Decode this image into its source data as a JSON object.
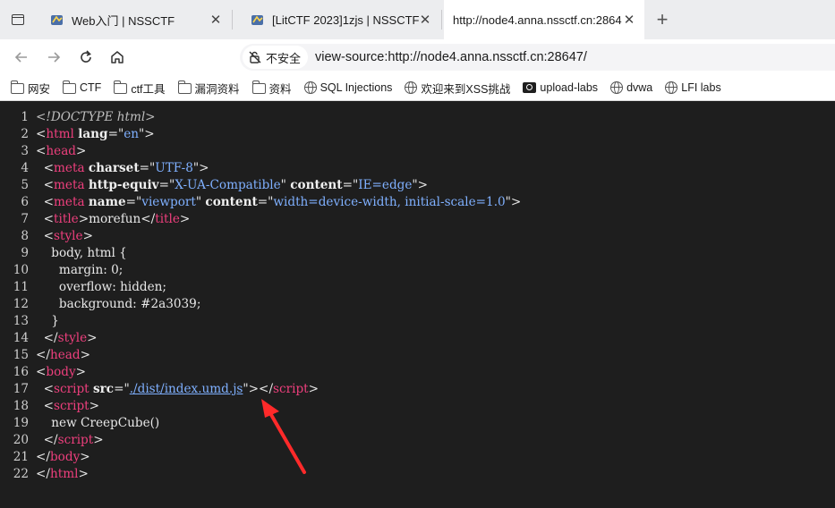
{
  "tabs": [
    {
      "title": "Web入门 | NSSCTF",
      "active": false,
      "closable": true
    },
    {
      "title": "[LitCTF 2023]1zjs | NSSCTF",
      "active": false,
      "closable": true
    },
    {
      "title": "http://node4.anna.nssctf.cn:2864",
      "active": true,
      "closable": true
    }
  ],
  "address_bar": {
    "security_label": "不安全",
    "url": "view-source:http://node4.anna.nssctf.cn:28647/"
  },
  "bookmarks": [
    {
      "label": "网安",
      "icon": "folder-icon"
    },
    {
      "label": "CTF",
      "icon": "folder-icon"
    },
    {
      "label": "ctf工具",
      "icon": "folder-icon"
    },
    {
      "label": "漏洞资料",
      "icon": "folder-icon"
    },
    {
      "label": "资料",
      "icon": "folder-icon"
    },
    {
      "label": "SQL Injections",
      "icon": "globe-icon"
    },
    {
      "label": "欢迎来到XSS挑战",
      "icon": "globe-icon"
    },
    {
      "label": "upload-labs",
      "icon": "upload-icon"
    },
    {
      "label": "dvwa",
      "icon": "globe-icon"
    },
    {
      "label": "LFI labs",
      "icon": "globe-icon"
    }
  ],
  "source_lines": [
    {
      "n": "1",
      "parts": [
        [
          "doctype",
          "<!DOCTYPE html>"
        ]
      ]
    },
    {
      "n": "2",
      "parts": [
        [
          "text",
          "<"
        ],
        [
          "tag",
          "html"
        ],
        [
          "text",
          " "
        ],
        [
          "attr",
          "lang"
        ],
        [
          "text",
          "=\""
        ],
        [
          "val",
          "en"
        ],
        [
          "text",
          "\">"
        ]
      ]
    },
    {
      "n": "3",
      "parts": [
        [
          "text",
          "<"
        ],
        [
          "tag",
          "head"
        ],
        [
          "text",
          ">"
        ]
      ]
    },
    {
      "n": "4",
      "parts": [
        [
          "text",
          "  <"
        ],
        [
          "tag",
          "meta"
        ],
        [
          "text",
          " "
        ],
        [
          "attr",
          "charset"
        ],
        [
          "text",
          "=\""
        ],
        [
          "val",
          "UTF-8"
        ],
        [
          "text",
          "\">"
        ]
      ]
    },
    {
      "n": "5",
      "parts": [
        [
          "text",
          "  <"
        ],
        [
          "tag",
          "meta"
        ],
        [
          "text",
          " "
        ],
        [
          "attr",
          "http-equiv"
        ],
        [
          "text",
          "=\""
        ],
        [
          "val",
          "X-UA-Compatible"
        ],
        [
          "text",
          "\" "
        ],
        [
          "attr",
          "content"
        ],
        [
          "text",
          "=\""
        ],
        [
          "val",
          "IE=edge"
        ],
        [
          "text",
          "\">"
        ]
      ]
    },
    {
      "n": "6",
      "parts": [
        [
          "text",
          "  <"
        ],
        [
          "tag",
          "meta"
        ],
        [
          "text",
          " "
        ],
        [
          "attr",
          "name"
        ],
        [
          "text",
          "=\""
        ],
        [
          "val",
          "viewport"
        ],
        [
          "text",
          "\" "
        ],
        [
          "attr",
          "content"
        ],
        [
          "text",
          "=\""
        ],
        [
          "val",
          "width=device-width, initial-scale=1.0"
        ],
        [
          "text",
          "\">"
        ]
      ]
    },
    {
      "n": "7",
      "parts": [
        [
          "text",
          "  <"
        ],
        [
          "tag",
          "title"
        ],
        [
          "text",
          ">morefun</"
        ],
        [
          "tag",
          "title"
        ],
        [
          "text",
          ">"
        ]
      ]
    },
    {
      "n": "8",
      "parts": [
        [
          "text",
          "  <"
        ],
        [
          "tag",
          "style"
        ],
        [
          "text",
          ">"
        ]
      ]
    },
    {
      "n": "9",
      "parts": [
        [
          "text",
          "    body, html {"
        ]
      ]
    },
    {
      "n": "10",
      "parts": [
        [
          "text",
          "      margin: 0;"
        ]
      ]
    },
    {
      "n": "11",
      "parts": [
        [
          "text",
          "      overflow: hidden;"
        ]
      ]
    },
    {
      "n": "12",
      "parts": [
        [
          "text",
          "      background: #2a3039;"
        ]
      ]
    },
    {
      "n": "13",
      "parts": [
        [
          "text",
          "    }"
        ]
      ]
    },
    {
      "n": "14",
      "parts": [
        [
          "text",
          "  </"
        ],
        [
          "tag",
          "style"
        ],
        [
          "text",
          ">"
        ]
      ]
    },
    {
      "n": "15",
      "parts": [
        [
          "text",
          "</"
        ],
        [
          "tag",
          "head"
        ],
        [
          "text",
          ">"
        ]
      ]
    },
    {
      "n": "16",
      "parts": [
        [
          "text",
          "<"
        ],
        [
          "tag",
          "body"
        ],
        [
          "text",
          ">"
        ]
      ]
    },
    {
      "n": "17",
      "parts": [
        [
          "text",
          "  <"
        ],
        [
          "tag",
          "script"
        ],
        [
          "text",
          " "
        ],
        [
          "attr",
          "src"
        ],
        [
          "text",
          "=\""
        ],
        [
          "link",
          "./dist/index.umd.js"
        ],
        [
          "text",
          "\"></"
        ],
        [
          "tag",
          "script"
        ],
        [
          "text",
          ">"
        ]
      ]
    },
    {
      "n": "18",
      "parts": [
        [
          "text",
          "  <"
        ],
        [
          "tag",
          "script"
        ],
        [
          "text",
          ">"
        ]
      ]
    },
    {
      "n": "19",
      "parts": [
        [
          "text",
          "    new CreepCube()"
        ]
      ]
    },
    {
      "n": "20",
      "parts": [
        [
          "text",
          "  </"
        ],
        [
          "tag",
          "script"
        ],
        [
          "text",
          ">"
        ]
      ]
    },
    {
      "n": "21",
      "parts": [
        [
          "text",
          "</"
        ],
        [
          "tag",
          "body"
        ],
        [
          "text",
          ">"
        ]
      ]
    },
    {
      "n": "22",
      "parts": [
        [
          "text",
          "</"
        ],
        [
          "tag",
          "html"
        ],
        [
          "text",
          ">"
        ]
      ]
    }
  ],
  "colors": {
    "tag": "#ee3f7d",
    "value": "#7fb0ff",
    "annotation_arrow": "#ff2a2a",
    "background": "#1e1e1e"
  }
}
